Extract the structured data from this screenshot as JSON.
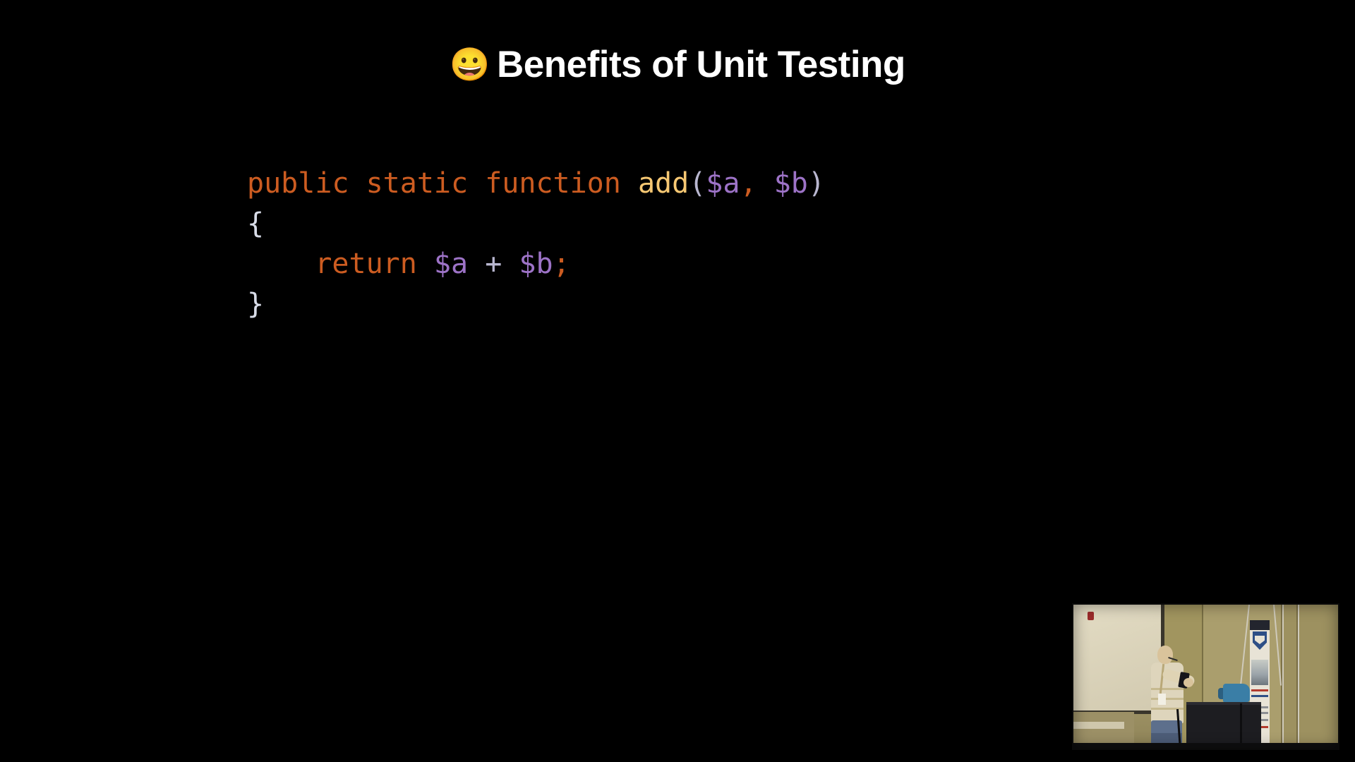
{
  "slide": {
    "background_color": "#000000",
    "title": {
      "emoji": "😀",
      "emoji_name": "grinning-face",
      "text": "Benefits of Unit Testing",
      "color": "#ffffff"
    },
    "code": {
      "language": "php",
      "font": "monospace",
      "lines": [
        {
          "tokens": [
            {
              "text": "public",
              "type": "keyword",
              "color": "#cc5c21"
            },
            {
              "text": " ",
              "type": "plain",
              "color": "#d8dce8"
            },
            {
              "text": "static",
              "type": "keyword",
              "color": "#cc5c21"
            },
            {
              "text": " ",
              "type": "plain",
              "color": "#d8dce8"
            },
            {
              "text": "function",
              "type": "keyword",
              "color": "#cc5c21"
            },
            {
              "text": " ",
              "type": "plain",
              "color": "#d8dce8"
            },
            {
              "text": "add",
              "type": "function",
              "color": "#f7c873"
            },
            {
              "text": "(",
              "type": "punct",
              "color": "#b9b7d0"
            },
            {
              "text": "$a",
              "type": "variable",
              "color": "#9d73c7"
            },
            {
              "text": ",",
              "type": "delim",
              "color": "#cc5c21"
            },
            {
              "text": " ",
              "type": "plain",
              "color": "#d8dce8"
            },
            {
              "text": "$b",
              "type": "variable",
              "color": "#9d73c7"
            },
            {
              "text": ")",
              "type": "punct",
              "color": "#b9b7d0"
            }
          ]
        },
        {
          "tokens": [
            {
              "text": "{",
              "type": "brace",
              "color": "#d8dce8"
            }
          ]
        },
        {
          "tokens": [
            {
              "text": "    ",
              "type": "plain",
              "color": "#d8dce8"
            },
            {
              "text": "return",
              "type": "keyword",
              "color": "#cc5c21"
            },
            {
              "text": " ",
              "type": "plain",
              "color": "#d8dce8"
            },
            {
              "text": "$a",
              "type": "variable",
              "color": "#9d73c7"
            },
            {
              "text": " ",
              "type": "plain",
              "color": "#d8dce8"
            },
            {
              "text": "+",
              "type": "operator",
              "color": "#b9b7d0"
            },
            {
              "text": " ",
              "type": "plain",
              "color": "#d8dce8"
            },
            {
              "text": "$b",
              "type": "variable",
              "color": "#9d73c7"
            },
            {
              "text": ";",
              "type": "delim",
              "color": "#cc5c21"
            }
          ]
        },
        {
          "tokens": [
            {
              "text": "}",
              "type": "brace",
              "color": "#d8dce8"
            }
          ]
        }
      ],
      "plain_text": "public static function add($a, $b)\n{\n    return $a + $b;\n}"
    }
  },
  "speaker_video": {
    "label": "speaker-camera-feed",
    "description": "Conference presenter standing beside a podium holding a phone, projection screen on the left, pull-up banner on the right",
    "position": "bottom-right",
    "border_color": "#0a0a0a"
  }
}
